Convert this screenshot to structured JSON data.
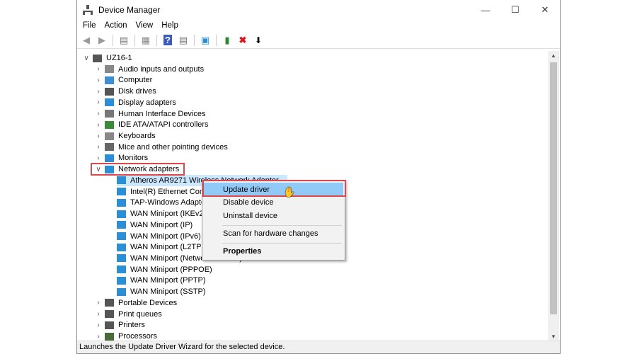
{
  "window": {
    "title": "Device Manager",
    "controls": [
      "minimize",
      "maximize",
      "close"
    ]
  },
  "menubar": [
    "File",
    "Action",
    "View",
    "Help"
  ],
  "toolbar": [
    "back-icon",
    "forward-icon",
    "properties-pane-icon",
    "show-hide-icon",
    "help-icon",
    "view-icon",
    "monitor-icon",
    "update-driver-icon",
    "uninstall-icon",
    "disable-icon"
  ],
  "tree": {
    "root": "UZ16-1",
    "categories_before": [
      "Audio inputs and outputs",
      "Computer",
      "Disk drives",
      "Display adapters",
      "Human Interface Devices",
      "IDE ATA/ATAPI controllers",
      "Keyboards",
      "Mice and other pointing devices",
      "Monitors"
    ],
    "expanded": "Network adapters",
    "children": [
      "Atheros AR9271 Wireless Network Adapter",
      "Intel(R) Ethernet Connection",
      "TAP-Windows Adapter",
      "WAN Miniport (IKEv2)",
      "WAN Miniport (IP)",
      "WAN Miniport (IPv6)",
      "WAN Miniport (L2TP)",
      "WAN Miniport (Network Monitor)",
      "WAN Miniport (PPPOE)",
      "WAN Miniport (PPTP)",
      "WAN Miniport (SSTP)"
    ],
    "categories_after": [
      "Portable Devices",
      "Print queues",
      "Printers",
      "Processors"
    ]
  },
  "context_menu": {
    "items": [
      "Update driver",
      "Disable device",
      "Uninstall device",
      "Scan for hardware changes",
      "Properties"
    ],
    "highlighted": "Update driver"
  },
  "status": "Launches the Update Driver Wizard for the selected device.",
  "colors": {
    "highlight_outline": "#e0474c",
    "selection": "#cce8ff",
    "menu_highlight": "#91c9f7"
  }
}
